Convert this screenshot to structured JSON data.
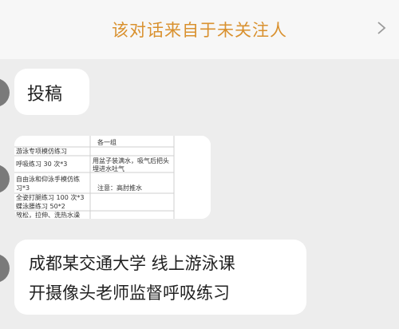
{
  "notice": {
    "text": "该对话来自于未关注人",
    "chevron": "chevron-right-icon"
  },
  "messages": {
    "m1": {
      "text": "投稿"
    },
    "image": {
      "rows": [
        {
          "left": "",
          "right": "各一组"
        },
        {
          "left": "游泳专项模仿练习",
          "right": ""
        },
        {
          "left": "呼吸练习 30 次*3",
          "right": "用盆子装满水，吸气后把头"
        },
        {
          "left": "",
          "right": "埋进水吐气"
        },
        {
          "left": "自由泳和仰泳手模仿练",
          "right": ""
        },
        {
          "left": "习*3",
          "right": "注意：高肘推水"
        },
        {
          "left": "全姿打腿练习 100 次*3",
          "right": ""
        },
        {
          "left": "蝶泳腰练习 50*2",
          "right": ""
        },
        {
          "left": "放松，拉伸、洗热水澡",
          "right": ""
        }
      ]
    },
    "m3": {
      "line1": "成都某交通大学  线上游泳课",
      "line2": "开摄像头老师监督呼吸练习"
    }
  },
  "colors": {
    "notice_text": "#d9912f",
    "background": "#ededed",
    "bubble": "#ffffff"
  }
}
